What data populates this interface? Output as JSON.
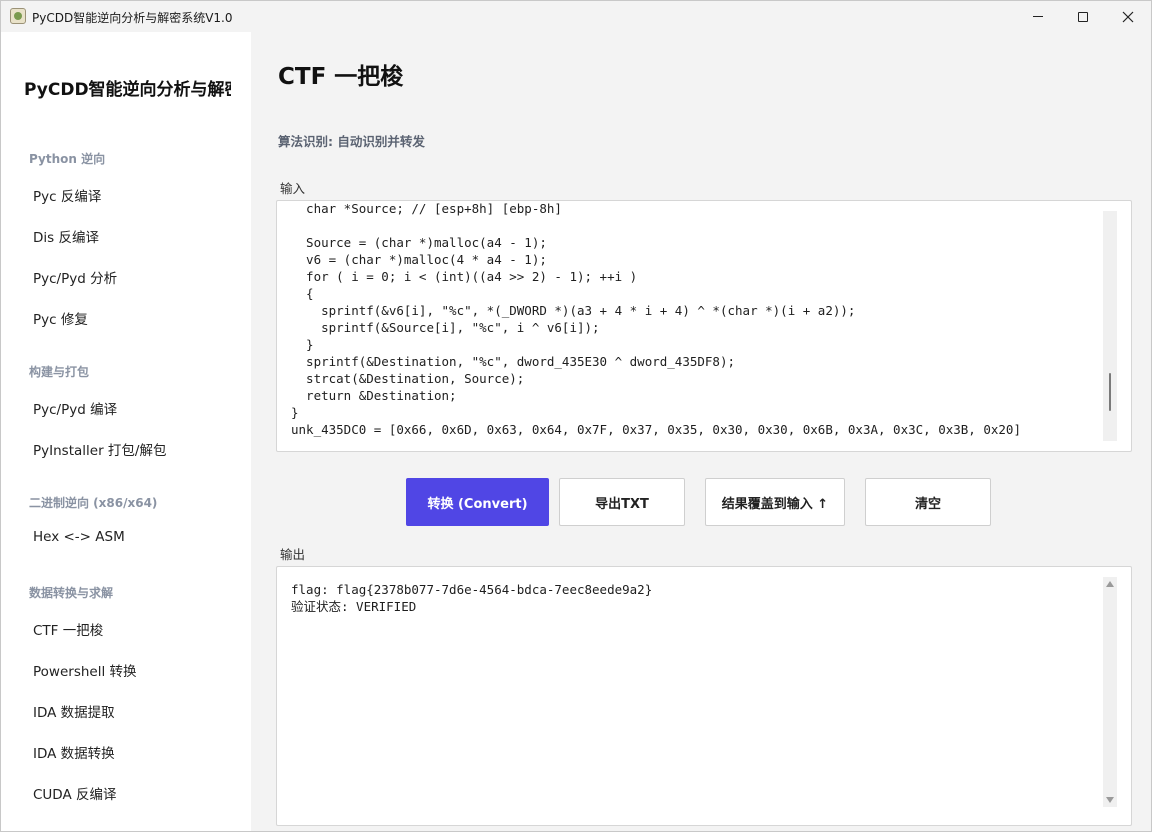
{
  "window": {
    "title": "PyCDD智能逆向分析与解密系统V1.0"
  },
  "sidebar": {
    "title": "PyCDD智能逆向分析与解密",
    "sections": [
      {
        "label": "Python 逆向",
        "items": [
          "Pyc 反编译",
          "Dis 反编译",
          "Pyc/Pyd 分析",
          "Pyc 修复"
        ]
      },
      {
        "label": "构建与打包",
        "items": [
          "Pyc/Pyd 编译",
          "PyInstaller 打包/解包"
        ]
      },
      {
        "label": "二进制逆向 (x86/x64)",
        "items": [
          "Hex <-> ASM"
        ]
      },
      {
        "label": "数据转换与求解",
        "items": [
          "CTF 一把梭",
          "Powershell 转换",
          "IDA 数据提取",
          "IDA 数据转换",
          "CUDA 反编译"
        ]
      }
    ]
  },
  "main": {
    "page_title": "CTF 一把梭",
    "algorithm_label": "算法识别: 自动识别并转发",
    "input_label": "输入",
    "output_label": "输出",
    "input_code": "  char *Source; // [esp+8h] [ebp-8h]\n\n  Source = (char *)malloc(a4 - 1);\n  v6 = (char *)malloc(4 * a4 - 1);\n  for ( i = 0; i < (int)((a4 >> 2) - 1); ++i )\n  {\n    sprintf(&v6[i], \"%c\", *(_DWORD *)(a3 + 4 * i + 4) ^ *(char *)(i + a2));\n    sprintf(&Source[i], \"%c\", i ^ v6[i]);\n  }\n  sprintf(&Destination, \"%c\", dword_435E30 ^ dword_435DF8);\n  strcat(&Destination, Source);\n  return &Destination;\n}\nunk_435DC0 = [0x66, 0x6D, 0x63, 0x64, 0x7F, 0x37, 0x35, 0x30, 0x30, 0x6B, 0x3A, 0x3C, 0x3B, 0x20]",
    "output_code": "flag: flag{2378b077-7d6e-4564-bdca-7eec8eede9a2}\n验证状态: VERIFIED",
    "buttons": {
      "convert": "转换 (Convert)",
      "export_txt": "导出TXT",
      "overwrite_input": "结果覆盖到输入 ↑",
      "clear": "清空"
    }
  },
  "colors": {
    "primary": "#5046e5",
    "sidebar_bg": "#ffffff",
    "main_bg": "#f3f3f3",
    "section_label": "#8a93a3"
  }
}
